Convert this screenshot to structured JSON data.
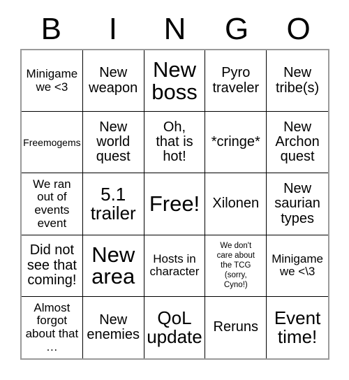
{
  "header": {
    "letters": [
      "B",
      "I",
      "N",
      "G",
      "O"
    ]
  },
  "grid": {
    "columns": 5,
    "rows": 5,
    "free_space_index": 12,
    "cells": [
      {
        "text": "Minigame\nwe <3",
        "size": "sm"
      },
      {
        "text": "New\nweapon",
        "size": "md"
      },
      {
        "text": "New\nboss",
        "size": "xl"
      },
      {
        "text": "Pyro\ntraveler",
        "size": "md"
      },
      {
        "text": "New\ntribe(s)",
        "size": "md"
      },
      {
        "text": "Freemogems",
        "size": "xs"
      },
      {
        "text": "New\nworld\nquest",
        "size": "md"
      },
      {
        "text": "Oh,\nthat is\nhot!",
        "size": "md"
      },
      {
        "text": "*cringe*",
        "size": "md"
      },
      {
        "text": "New\nArchon\nquest",
        "size": "md"
      },
      {
        "text": "We ran\nout of\nevents\nevent",
        "size": "sm"
      },
      {
        "text": "5.1\ntrailer",
        "size": "lg"
      },
      {
        "text": "Free!",
        "size": "xl"
      },
      {
        "text": "Xilonen",
        "size": "md"
      },
      {
        "text": "New\nsaurian\ntypes",
        "size": "md"
      },
      {
        "text": "Did not\nsee that\ncoming!",
        "size": "md"
      },
      {
        "text": "New\narea",
        "size": "xl"
      },
      {
        "text": "Hosts in\ncharacter",
        "size": "sm"
      },
      {
        "text": "We don't\ncare about\nthe TCG\n(sorry,\nCyno!)",
        "size": "xxs"
      },
      {
        "text": "Minigame\nwe <\\3",
        "size": "sm"
      },
      {
        "text": "Almost\nforgot\nabout that\n…",
        "size": "sm"
      },
      {
        "text": "New\nenemies",
        "size": "md"
      },
      {
        "text": "QoL\nupdate",
        "size": "lg"
      },
      {
        "text": "Reruns",
        "size": "md"
      },
      {
        "text": "Event\ntime!",
        "size": "lg"
      }
    ]
  },
  "colors": {
    "background": "#ffffff",
    "text": "#000000",
    "grid_line": "#000000",
    "outer_frame": "#9a9a9a"
  }
}
